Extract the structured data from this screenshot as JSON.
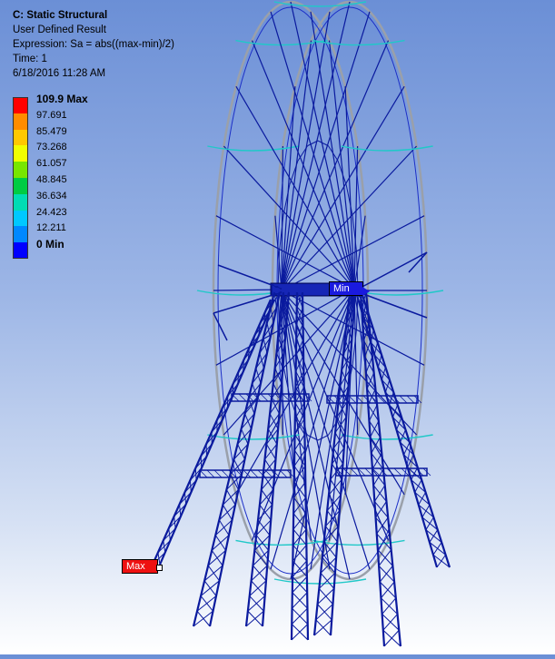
{
  "header": {
    "title": "C: Static Structural",
    "result_type": "User Defined Result",
    "expression": "Expression: Sa = abs((max-min)/2)",
    "time": "Time: 1",
    "timestamp": "6/18/2016 11:28 AM"
  },
  "legend": {
    "items": [
      {
        "label": "109.9 Max",
        "color": "#ff0000",
        "bold": true
      },
      {
        "label": "97.691",
        "color": "#ff8c00",
        "bold": false
      },
      {
        "label": "85.479",
        "color": "#ffc800",
        "bold": false
      },
      {
        "label": "73.268",
        "color": "#f0ff00",
        "bold": false
      },
      {
        "label": "61.057",
        "color": "#78e600",
        "bold": false
      },
      {
        "label": "48.845",
        "color": "#00cc44",
        "bold": false
      },
      {
        "label": "36.634",
        "color": "#00dcb4",
        "bold": false
      },
      {
        "label": "24.423",
        "color": "#00c8ff",
        "bold": false
      },
      {
        "label": "12.211",
        "color": "#0088ff",
        "bold": false
      },
      {
        "label": "0 Min",
        "color": "#0000ff",
        "bold": true
      }
    ]
  },
  "probes": {
    "min_label": "Min",
    "max_label": "Max"
  },
  "colors": {
    "structure": "#0a1a9e",
    "structure_light": "#1c2fc7",
    "wheel_rim": "#9aa0aa",
    "cabin_accent": "#20c8c8"
  }
}
